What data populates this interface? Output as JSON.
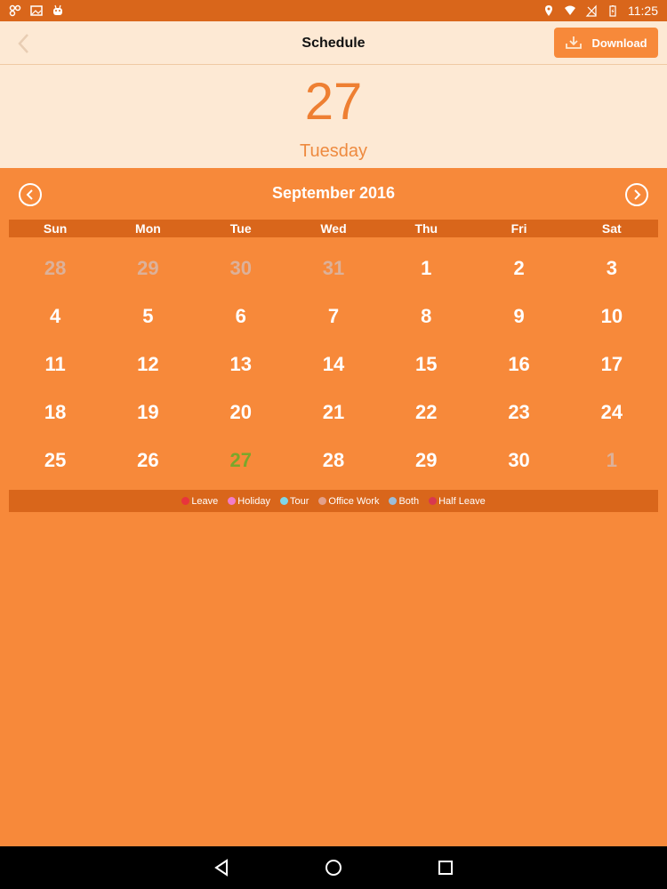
{
  "status_bar": {
    "time": "11:25"
  },
  "app_bar": {
    "title": "Schedule",
    "download_label": "Download"
  },
  "selected": {
    "day": "27",
    "weekday": "Tuesday"
  },
  "calendar": {
    "month_title": "September 2016",
    "weekdays": [
      "Sun",
      "Mon",
      "Tue",
      "Wed",
      "Thu",
      "Fri",
      "Sat"
    ],
    "days": [
      {
        "label": "28",
        "state": "other"
      },
      {
        "label": "29",
        "state": "other"
      },
      {
        "label": "30",
        "state": "other"
      },
      {
        "label": "31",
        "state": "other"
      },
      {
        "label": "1",
        "state": "current"
      },
      {
        "label": "2",
        "state": "current"
      },
      {
        "label": "3",
        "state": "current"
      },
      {
        "label": "4",
        "state": "current"
      },
      {
        "label": "5",
        "state": "current"
      },
      {
        "label": "6",
        "state": "current"
      },
      {
        "label": "7",
        "state": "current"
      },
      {
        "label": "8",
        "state": "current"
      },
      {
        "label": "9",
        "state": "current"
      },
      {
        "label": "10",
        "state": "current"
      },
      {
        "label": "11",
        "state": "current"
      },
      {
        "label": "12",
        "state": "current"
      },
      {
        "label": "13",
        "state": "current"
      },
      {
        "label": "14",
        "state": "current"
      },
      {
        "label": "15",
        "state": "current"
      },
      {
        "label": "16",
        "state": "current"
      },
      {
        "label": "17",
        "state": "current"
      },
      {
        "label": "18",
        "state": "current"
      },
      {
        "label": "19",
        "state": "current"
      },
      {
        "label": "20",
        "state": "current"
      },
      {
        "label": "21",
        "state": "current"
      },
      {
        "label": "22",
        "state": "current"
      },
      {
        "label": "23",
        "state": "current"
      },
      {
        "label": "24",
        "state": "current"
      },
      {
        "label": "25",
        "state": "current"
      },
      {
        "label": "26",
        "state": "current"
      },
      {
        "label": "27",
        "state": "today"
      },
      {
        "label": "28",
        "state": "current"
      },
      {
        "label": "29",
        "state": "current"
      },
      {
        "label": "30",
        "state": "current"
      },
      {
        "label": "1",
        "state": "other"
      }
    ]
  },
  "legend": [
    {
      "label": "Leave",
      "color": "#e8343c"
    },
    {
      "label": "Holiday",
      "color": "#f27dc9"
    },
    {
      "label": "Tour",
      "color": "#7fd6e8"
    },
    {
      "label": "Office Work",
      "color": "#e3a08a"
    },
    {
      "label": "Both",
      "color": "#9dbdd8"
    },
    {
      "label": "Half Leave",
      "color": "#d8384f"
    }
  ],
  "colors": {
    "accent": "#f7893a",
    "dark_accent": "#d9661b",
    "panel": "#fde9d4",
    "today": "#7aa72b"
  }
}
